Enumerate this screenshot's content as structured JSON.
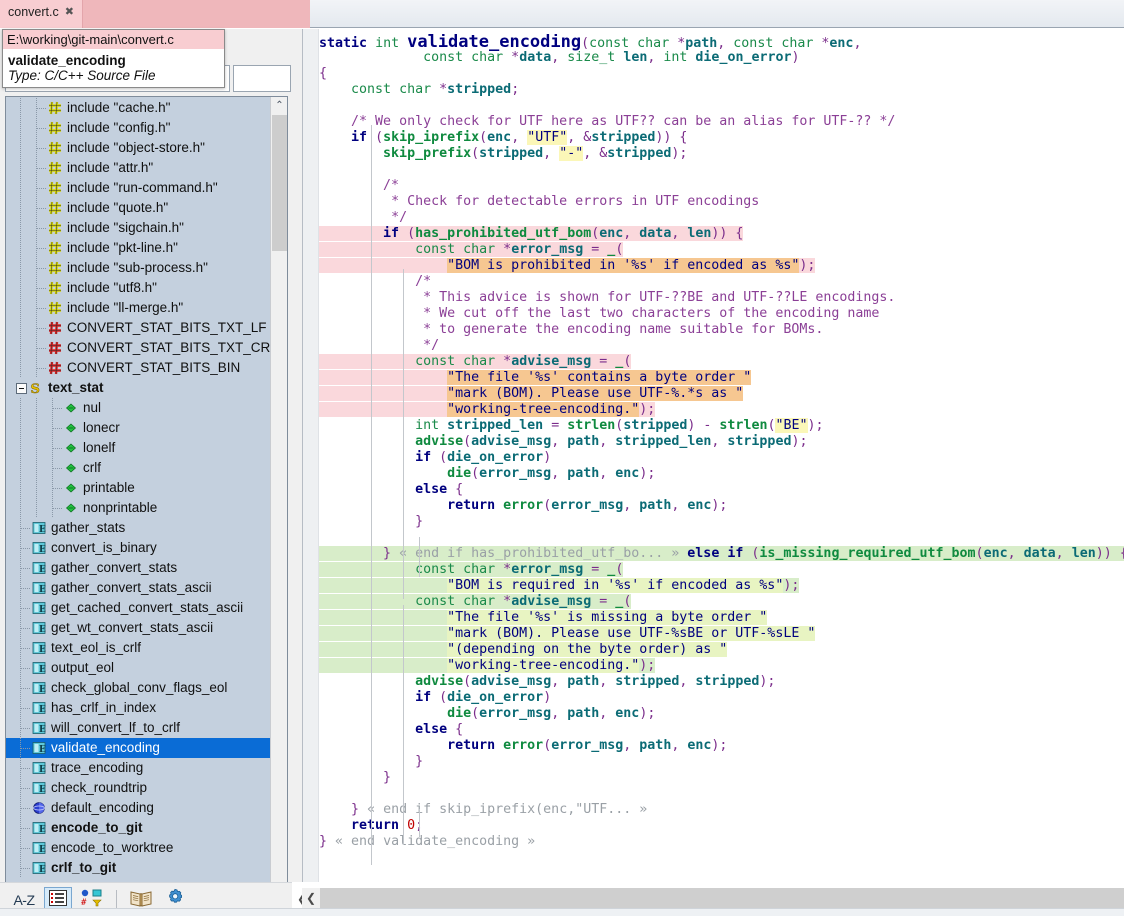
{
  "tab": {
    "title": "convert.c",
    "close_icon": "close-icon",
    "close_glyph": "✖"
  },
  "tooltip": {
    "path": "E:\\working\\git-main\\convert.c",
    "name": "validate_encoding",
    "type": "Type: C/C++ Source File"
  },
  "search": {
    "value": "",
    "placeholder": ""
  },
  "tree": {
    "items": [
      {
        "label": "include \"cache.h\"",
        "icon": "hash-yellow-icon",
        "depth": 2,
        "bold": false,
        "selected": false
      },
      {
        "label": "include \"config.h\"",
        "icon": "hash-yellow-icon",
        "depth": 2,
        "bold": false,
        "selected": false
      },
      {
        "label": "include \"object-store.h\"",
        "icon": "hash-yellow-icon",
        "depth": 2,
        "bold": false,
        "selected": false
      },
      {
        "label": "include \"attr.h\"",
        "icon": "hash-yellow-icon",
        "depth": 2,
        "bold": false,
        "selected": false
      },
      {
        "label": "include \"run-command.h\"",
        "icon": "hash-yellow-icon",
        "depth": 2,
        "bold": false,
        "selected": false
      },
      {
        "label": "include \"quote.h\"",
        "icon": "hash-yellow-icon",
        "depth": 2,
        "bold": false,
        "selected": false
      },
      {
        "label": "include \"sigchain.h\"",
        "icon": "hash-yellow-icon",
        "depth": 2,
        "bold": false,
        "selected": false
      },
      {
        "label": "include \"pkt-line.h\"",
        "icon": "hash-yellow-icon",
        "depth": 2,
        "bold": false,
        "selected": false
      },
      {
        "label": "include \"sub-process.h\"",
        "icon": "hash-yellow-icon",
        "depth": 2,
        "bold": false,
        "selected": false
      },
      {
        "label": "include \"utf8.h\"",
        "icon": "hash-yellow-icon",
        "depth": 2,
        "bold": false,
        "selected": false
      },
      {
        "label": "include \"ll-merge.h\"",
        "icon": "hash-yellow-icon",
        "depth": 2,
        "bold": false,
        "selected": false
      },
      {
        "label": "CONVERT_STAT_BITS_TXT_LF",
        "icon": "hash-red-icon",
        "depth": 2,
        "bold": false,
        "selected": false
      },
      {
        "label": "CONVERT_STAT_BITS_TXT_CRLF",
        "icon": "hash-red-icon",
        "depth": 2,
        "bold": false,
        "selected": false
      },
      {
        "label": "CONVERT_STAT_BITS_BIN",
        "icon": "hash-red-icon",
        "depth": 2,
        "bold": false,
        "selected": false
      },
      {
        "label": "text_stat",
        "icon": "struct-icon",
        "depth": 0,
        "bold": true,
        "selected": false,
        "expander": "collapse"
      },
      {
        "label": "nul",
        "icon": "field-icon",
        "depth": 3,
        "bold": false,
        "selected": false
      },
      {
        "label": "lonecr",
        "icon": "field-icon",
        "depth": 3,
        "bold": false,
        "selected": false
      },
      {
        "label": "lonelf",
        "icon": "field-icon",
        "depth": 3,
        "bold": false,
        "selected": false
      },
      {
        "label": "crlf",
        "icon": "field-icon",
        "depth": 3,
        "bold": false,
        "selected": false
      },
      {
        "label": "printable",
        "icon": "field-icon",
        "depth": 3,
        "bold": false,
        "selected": false
      },
      {
        "label": "nonprintable",
        "icon": "field-icon",
        "depth": 3,
        "bold": false,
        "selected": false
      },
      {
        "label": "gather_stats",
        "icon": "function-icon",
        "depth": 1,
        "bold": false,
        "selected": false
      },
      {
        "label": "convert_is_binary",
        "icon": "function-icon",
        "depth": 1,
        "bold": false,
        "selected": false
      },
      {
        "label": "gather_convert_stats",
        "icon": "function-icon",
        "depth": 1,
        "bold": false,
        "selected": false
      },
      {
        "label": "gather_convert_stats_ascii",
        "icon": "function-icon",
        "depth": 1,
        "bold": false,
        "selected": false
      },
      {
        "label": "get_cached_convert_stats_ascii",
        "icon": "function-icon",
        "depth": 1,
        "bold": false,
        "selected": false
      },
      {
        "label": "get_wt_convert_stats_ascii",
        "icon": "function-icon",
        "depth": 1,
        "bold": false,
        "selected": false
      },
      {
        "label": "text_eol_is_crlf",
        "icon": "function-icon",
        "depth": 1,
        "bold": false,
        "selected": false
      },
      {
        "label": "output_eol",
        "icon": "function-icon",
        "depth": 1,
        "bold": false,
        "selected": false
      },
      {
        "label": "check_global_conv_flags_eol",
        "icon": "function-icon",
        "depth": 1,
        "bold": false,
        "selected": false
      },
      {
        "label": "has_crlf_in_index",
        "icon": "function-icon",
        "depth": 1,
        "bold": false,
        "selected": false
      },
      {
        "label": "will_convert_lf_to_crlf",
        "icon": "function-icon",
        "depth": 1,
        "bold": false,
        "selected": false
      },
      {
        "label": "validate_encoding",
        "icon": "function-icon",
        "depth": 1,
        "bold": false,
        "selected": true
      },
      {
        "label": "trace_encoding",
        "icon": "function-icon",
        "depth": 1,
        "bold": false,
        "selected": false
      },
      {
        "label": "check_roundtrip",
        "icon": "function-icon",
        "depth": 1,
        "bold": false,
        "selected": false
      },
      {
        "label": "default_encoding",
        "icon": "variable-icon",
        "depth": 1,
        "bold": false,
        "selected": false
      },
      {
        "label": "encode_to_git",
        "icon": "function-icon",
        "depth": 1,
        "bold": true,
        "selected": false
      },
      {
        "label": "encode_to_worktree",
        "icon": "function-icon",
        "depth": 1,
        "bold": false,
        "selected": false
      },
      {
        "label": "crlf_to_git",
        "icon": "function-icon",
        "depth": 1,
        "bold": true,
        "selected": false
      }
    ]
  },
  "toolbar": {
    "sort_az_label": "A-Z",
    "buttons": [
      {
        "name": "sort-alphabetical-button",
        "icon": "sort-az-icon",
        "active": false
      },
      {
        "name": "list-view-button",
        "icon": "list-icon",
        "active": true
      },
      {
        "name": "group-by-type-button",
        "icon": "filter-icon",
        "active": false
      },
      {
        "name": "documentation-button",
        "icon": "book-icon",
        "active": false
      },
      {
        "name": "settings-button",
        "icon": "gear-icon",
        "active": false
      }
    ]
  },
  "code": {
    "lines": [
      "static int validate_encoding(const char *path, const char *enc,",
      "             const char *data, size_t len, int die_on_error)",
      "{",
      "    const char *stripped;",
      "",
      "    /* We only check for UTF here as UTF?? can be an alias for UTF-?? */",
      "    if (skip_iprefix(enc, \"UTF\", &stripped)) {",
      "        skip_prefix(stripped, \"-\", &stripped);",
      "",
      "        /*",
      "         * Check for detectable errors in UTF encodings",
      "         */",
      "        if (has_prohibited_utf_bom(enc, data, len)) {",
      "            const char *error_msg = _(",
      "                \"BOM is prohibited in '%s' if encoded as %s\");",
      "            /*",
      "             * This advice is shown for UTF-??BE and UTF-??LE encodings.",
      "             * We cut off the last two characters of the encoding name",
      "             * to generate the encoding name suitable for BOMs.",
      "             */",
      "            const char *advise_msg = _(",
      "                \"The file '%s' contains a byte order \"",
      "                \"mark (BOM). Please use UTF-%.*s as \"",
      "                \"working-tree-encoding.\");",
      "            int stripped_len = strlen(stripped) - strlen(\"BE\");",
      "            advise(advise_msg, path, stripped_len, stripped);",
      "            if (die_on_error)",
      "                die(error_msg, path, enc);",
      "            else {",
      "                return error(error_msg, path, enc);",
      "            }",
      "",
      "        } « end if has_prohibited_utf_bo... » else if (is_missing_required_utf_bom(enc, data, len)) {",
      "            const char *error_msg = _(",
      "                \"BOM is required in '%s' if encoded as %s\");",
      "            const char *advise_msg = _(",
      "                \"The file '%s' is missing a byte order \"",
      "                \"mark (BOM). Please use UTF-%sBE or UTF-%sLE \"",
      "                \"(depending on the byte order) as \"",
      "                \"working-tree-encoding.\");",
      "            advise(advise_msg, path, stripped, stripped);",
      "            if (die_on_error)",
      "                die(error_msg, path, enc);",
      "            else {",
      "                return error(error_msg, path, enc);",
      "            }",
      "        }",
      "",
      "    } « end if skip_iprefix(enc,\"UTF... »",
      "    return 0;",
      "} « end validate_encoding »"
    ],
    "fold_markers": [
      "« end if has_prohibited_utf_bo... »",
      "« end if skip_iprefix(enc,\"UTF... »",
      "« end validate_encoding »"
    ]
  },
  "scroll": {
    "vertical_up_glyph": "⌃",
    "vertical_down_glyph": "⌄",
    "horizontal_left_glyph": "❮",
    "splitter_collapse_glyph": "❮"
  },
  "colors": {
    "tab_active": "#f8cdd1",
    "tree_background": "#c4d0de",
    "selection_blue": "#0a6cd6",
    "block_pink": "#fad8dc",
    "block_green": "#d8edc9",
    "string_highlight_yellow": "#fbf7b8",
    "string_highlight_orange": "#f6c791",
    "string_highlight_green": "#e8f4c2"
  }
}
